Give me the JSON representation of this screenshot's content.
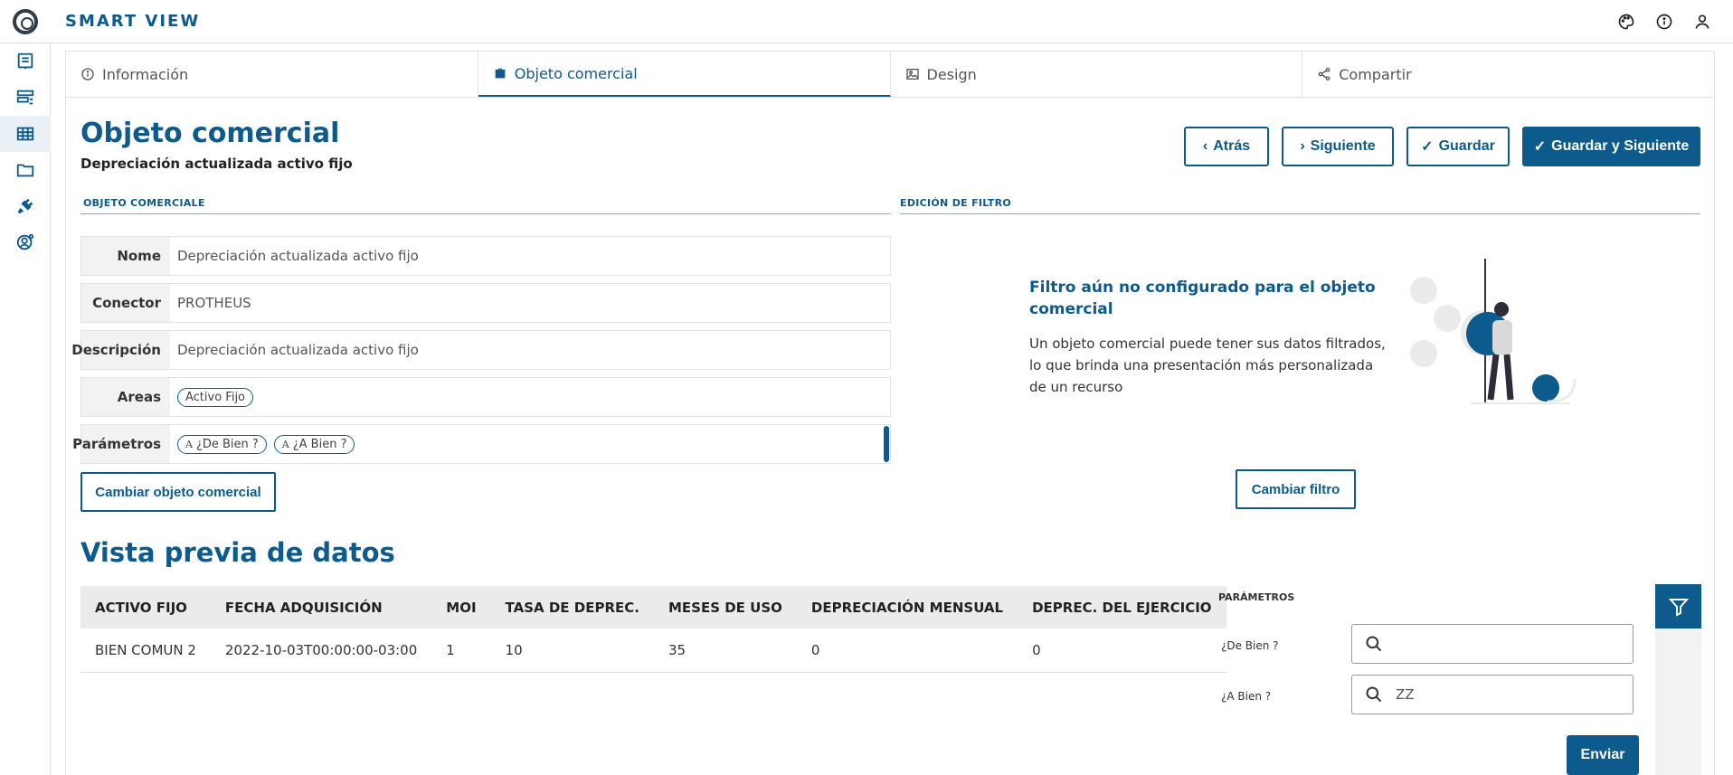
{
  "app": {
    "title": "SMART VIEW"
  },
  "tabs": [
    {
      "label": "Información",
      "icon": "info-icon"
    },
    {
      "label": "Objeto comercial",
      "icon": "briefcase-icon",
      "active": true
    },
    {
      "label": "Design",
      "icon": "image-icon"
    },
    {
      "label": "Compartir",
      "icon": "share-icon"
    }
  ],
  "header": {
    "title": "Objeto comercial",
    "subtitle": "Depreciación actualizada activo fijo"
  },
  "actions": {
    "back": "Atrás",
    "next": "Siguiente",
    "save": "Guardar",
    "save_next": "Guardar y Siguiente"
  },
  "business_object": {
    "section_label": "OBJETO COMERCIALE",
    "fields": [
      {
        "label": "Nome",
        "value": "Depreciación actualizada activo fijo"
      },
      {
        "label": "Conector",
        "value": "PROTHEUS"
      },
      {
        "label": "Descripción",
        "value": "Depreciación actualizada activo fijo"
      },
      {
        "label": "Areas",
        "chips": [
          "Activo Fijo"
        ]
      },
      {
        "label": "Parámetros",
        "chips": [
          "¿De Bien ?",
          "¿A Bien ?"
        ],
        "chip_prefix": "A"
      }
    ],
    "change_button": "Cambiar objeto comercial"
  },
  "filter": {
    "section_label": "EDICIÓN DE FILTRO",
    "empty_title": "Filtro aún no configurado para el objeto comercial",
    "empty_text": "Un objeto comercial puede tener sus datos filtrados, lo que brinda una presentación más personalizada de un recurso",
    "change_button": "Cambiar filtro"
  },
  "preview": {
    "title": "Vista previa de datos",
    "columns": [
      "ACTIVO FIJO",
      "FECHA ADQUISICIÓN",
      "MOI",
      "TASA DE DEPREC.",
      "MESES DE USO",
      "DEPRECIACIÓN MENSUAL",
      "DEPREC. DEL EJERCICIO"
    ],
    "rows": [
      [
        "BIEN COMUN 2",
        "2022-10-03T00:00:00-03:00",
        "1",
        "10",
        "35",
        "0",
        "0"
      ]
    ]
  },
  "parameters_panel": {
    "label": "PARÁMETROS",
    "params": [
      {
        "label": "¿De Bien ?",
        "value": ""
      },
      {
        "label": "¿A Bien ?",
        "value": "ZZ"
      }
    ],
    "submit": "Enviar"
  },
  "colors": {
    "primary": "#0d5a8c"
  }
}
